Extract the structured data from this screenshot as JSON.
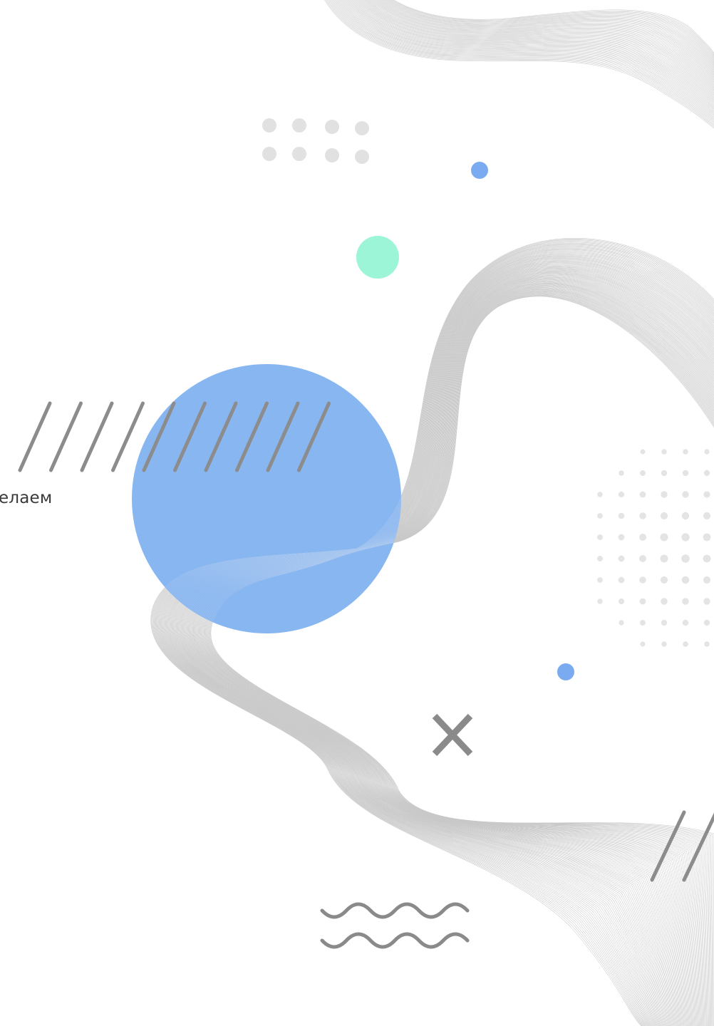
{
  "page": {
    "partial_text": "елаем"
  },
  "colors": {
    "background": "#ffffff",
    "accent_blue": "#7aaaf0",
    "accent_mint": "#9bf5d6",
    "dot_gray": "#e1e1e1",
    "stripe_gray": "#8c8c8c",
    "wave_line": "#c9c9c9",
    "text": "#3a3a3a"
  },
  "decor": {
    "icons": [
      "wave-ribbon",
      "hatch-stripes",
      "dot-grid",
      "cross-icon",
      "zigzag-wave-icon"
    ]
  }
}
